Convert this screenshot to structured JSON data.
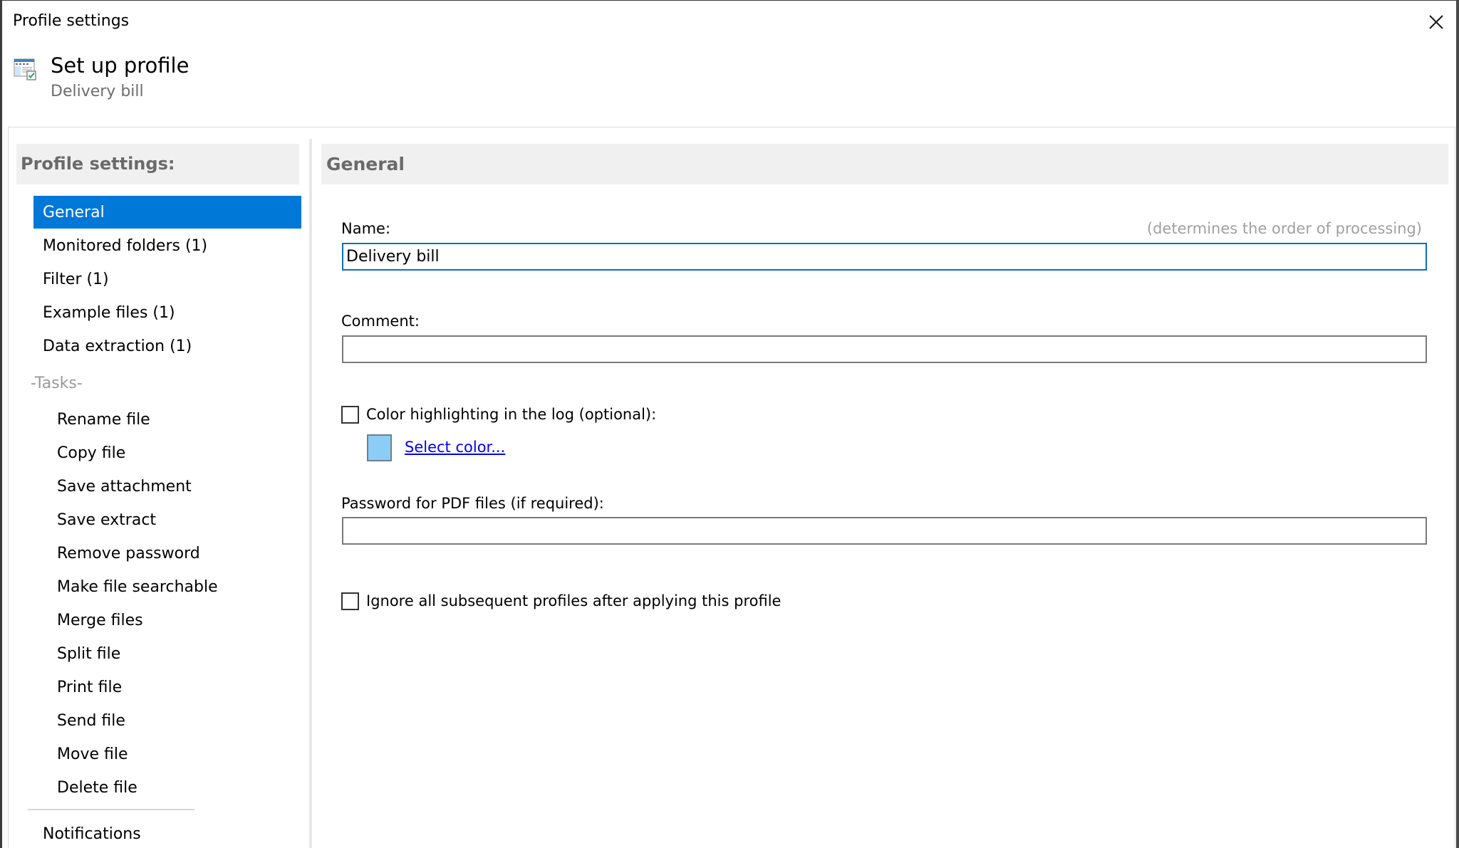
{
  "window": {
    "title": "Profile settings",
    "close_icon": "close-icon"
  },
  "header": {
    "icon": "profile-settings-icon",
    "title": "Set up profile",
    "subtitle": "Delivery bill"
  },
  "sidebar": {
    "heading": "Profile settings:",
    "items": [
      {
        "label": "General",
        "selected": true
      },
      {
        "label": "Monitored folders (1)",
        "selected": false
      },
      {
        "label": "Filter (1)",
        "selected": false
      },
      {
        "label": "Example files (1)",
        "selected": false
      },
      {
        "label": "Data extraction (1)",
        "selected": false
      }
    ],
    "tasks_label": "-Tasks-",
    "tasks": [
      {
        "label": "Rename file"
      },
      {
        "label": "Copy file"
      },
      {
        "label": "Save attachment"
      },
      {
        "label": "Save extract"
      },
      {
        "label": "Remove password"
      },
      {
        "label": "Make file searchable"
      },
      {
        "label": "Merge files"
      },
      {
        "label": "Split file"
      },
      {
        "label": "Print file"
      },
      {
        "label": "Send file"
      },
      {
        "label": "Move file"
      },
      {
        "label": "Delete file"
      }
    ],
    "footer_item": {
      "label": "Notifications"
    }
  },
  "main": {
    "heading": "General",
    "name": {
      "label": "Name:",
      "hint": "(determines the order of processing)",
      "value": "Delivery bill"
    },
    "comment": {
      "label": "Comment:",
      "value": ""
    },
    "color_highlighting": {
      "label": "Color highlighting in the log (optional):",
      "checked": false,
      "swatch_color": "#8ccdf8",
      "select_link": "Select color..."
    },
    "pdf_password": {
      "label": "Password for PDF files (if required):",
      "value": ""
    },
    "ignore_subsequent": {
      "label": "Ignore all subsequent profiles after applying this profile",
      "checked": false
    }
  },
  "colors": {
    "accent": "#0078d7",
    "focus_border": "#0a6fc2",
    "link": "#0000ee",
    "header_bg": "#f0f0f0"
  }
}
